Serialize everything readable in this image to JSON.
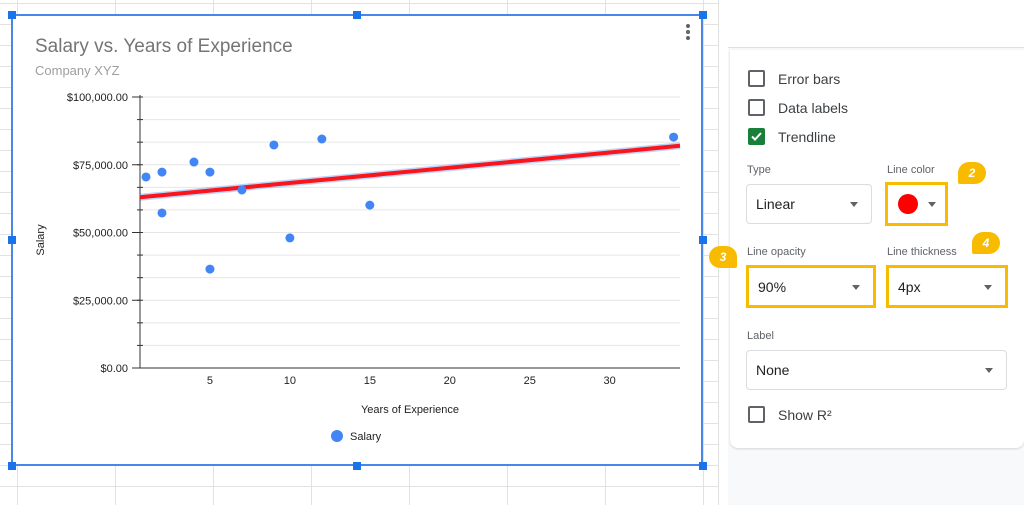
{
  "chart": {
    "title": "Salary vs. Years of Experience",
    "subtitle": "Company XYZ",
    "menu_icon": "more-vert-icon"
  },
  "chart_data": {
    "type": "scatter",
    "title": "Salary vs. Years of Experience",
    "subtitle": "Company XYZ",
    "xlabel": "Years of Experience",
    "ylabel": "Salary",
    "xlim": [
      0.625,
      34.4
    ],
    "ylim": [
      0,
      100000
    ],
    "x_ticks": [
      5,
      10,
      15,
      20,
      25,
      30
    ],
    "x_tick_labels": [
      "5",
      "10",
      "15",
      "20",
      "25",
      "30"
    ],
    "y_ticks": [
      0,
      25000,
      50000,
      75000,
      100000
    ],
    "y_tick_labels": [
      "$0.00",
      "$25,000.00",
      "$50,000.00",
      "$75,000.00",
      "$100,000.00"
    ],
    "grid": true,
    "legend": {
      "position": "bottom",
      "entries": [
        "Salary"
      ]
    },
    "series": [
      {
        "name": "Salary",
        "color": "#4285f4",
        "points": [
          {
            "x": 1,
            "y": 70500
          },
          {
            "x": 2,
            "y": 72300
          },
          {
            "x": 2,
            "y": 57200
          },
          {
            "x": 4,
            "y": 76000
          },
          {
            "x": 5,
            "y": 72300
          },
          {
            "x": 5,
            "y": 36500
          },
          {
            "x": 7,
            "y": 65700
          },
          {
            "x": 9,
            "y": 82300
          },
          {
            "x": 10,
            "y": 48000
          },
          {
            "x": 12,
            "y": 84500
          },
          {
            "x": 15,
            "y": 60100
          },
          {
            "x": 34,
            "y": 85200
          }
        ]
      }
    ],
    "trendline": {
      "type": "linear",
      "color": "#ff0000",
      "opacity": 0.9,
      "start": {
        "x": 0.625,
        "y": 63000
      },
      "end": {
        "x": 34.4,
        "y": 82000
      }
    }
  },
  "panel": {
    "checkboxes": [
      {
        "label": "Error bars",
        "checked": false
      },
      {
        "label": "Data labels",
        "checked": false
      },
      {
        "label": "Trendline",
        "checked": true
      }
    ],
    "type": {
      "label": "Type",
      "value": "Linear"
    },
    "line_color": {
      "label": "Line color",
      "value": "#ff0000"
    },
    "line_opacity": {
      "label": "Line opacity",
      "value": "90%"
    },
    "line_thickness": {
      "label": "Line thickness",
      "value": "4px"
    },
    "trend_label": {
      "label": "Label",
      "value": "None"
    },
    "show_r2": {
      "label": "Show R²",
      "checked": false
    }
  },
  "callouts": [
    "2",
    "3",
    "4"
  ]
}
